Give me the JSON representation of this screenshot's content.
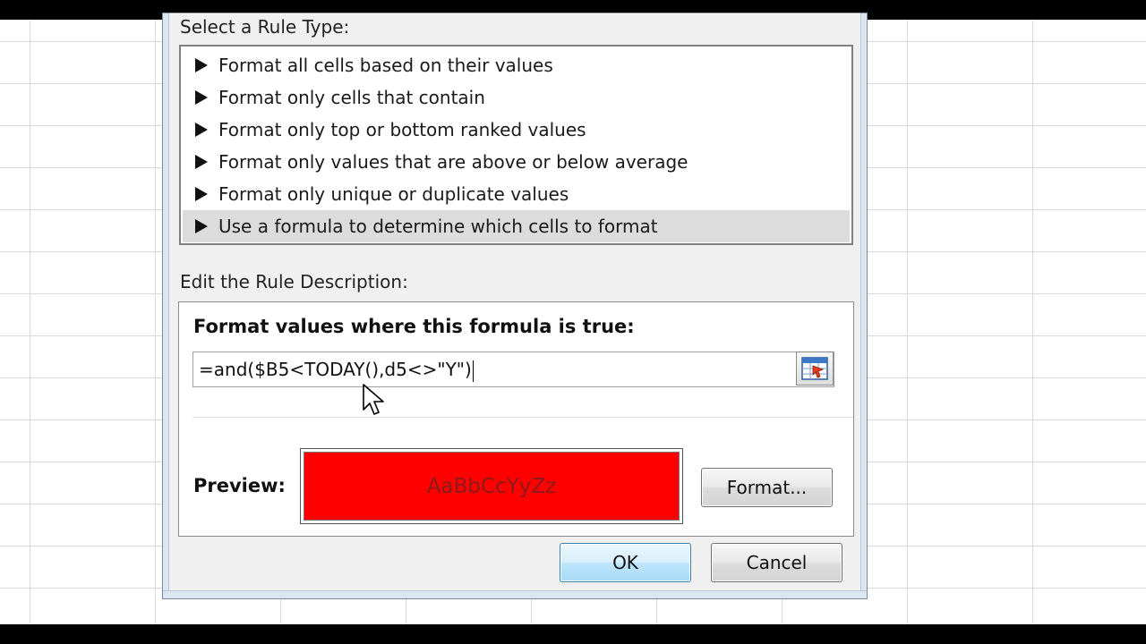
{
  "dialog": {
    "select_rule_label": "Select a Rule Type:",
    "rule_types": [
      {
        "label": "Format all cells based on their values",
        "selected": false
      },
      {
        "label": "Format only cells that contain",
        "selected": false
      },
      {
        "label": "Format only top or bottom ranked values",
        "selected": false
      },
      {
        "label": "Format only values that are above or below average",
        "selected": false
      },
      {
        "label": "Format only unique or duplicate values",
        "selected": false
      },
      {
        "label": "Use a formula to determine which cells to format",
        "selected": true
      }
    ],
    "edit_rule_label": "Edit the Rule Description:",
    "formula_title": "Format values where this formula is true:",
    "formula_value": "=and($B5<TODAY(),d5<>\"Y\")",
    "preview_label": "Preview:",
    "preview_text": "AaBbCcYyZz",
    "preview_fill_color": "#ff0000",
    "format_button": "Format...",
    "ok_button": "OK",
    "cancel_button": "Cancel"
  },
  "icons": {
    "expand_arrow": "triangle-right-icon",
    "range_select": "range-select-icon",
    "cursor": "mouse-pointer-icon"
  },
  "colors": {
    "default_button_accent": "#3c7fb1",
    "selected_row": "#dcdcdc"
  }
}
